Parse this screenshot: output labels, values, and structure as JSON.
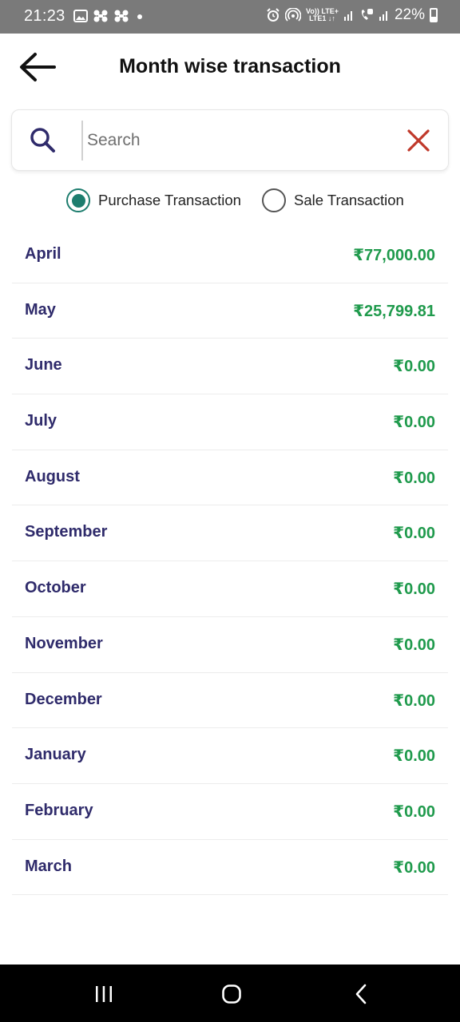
{
  "status_bar": {
    "time": "21:23",
    "network_top": "Vo)) LTE+",
    "network_bottom": "LTE1 ↓↑",
    "battery": "22%"
  },
  "header": {
    "title": "Month wise transaction"
  },
  "search": {
    "placeholder": "Search",
    "value": ""
  },
  "filter": {
    "options": [
      {
        "label": "Purchase Transaction",
        "selected": true
      },
      {
        "label": "Sale Transaction",
        "selected": false
      }
    ]
  },
  "months": [
    {
      "month": "April",
      "amount": "₹77,000.00"
    },
    {
      "month": "May",
      "amount": "₹25,799.81"
    },
    {
      "month": "June",
      "amount": "₹0.00"
    },
    {
      "month": "July",
      "amount": "₹0.00"
    },
    {
      "month": "August",
      "amount": "₹0.00"
    },
    {
      "month": "September",
      "amount": "₹0.00"
    },
    {
      "month": "October",
      "amount": "₹0.00"
    },
    {
      "month": "November",
      "amount": "₹0.00"
    },
    {
      "month": "December",
      "amount": "₹0.00"
    },
    {
      "month": "January",
      "amount": "₹0.00"
    },
    {
      "month": "February",
      "amount": "₹0.00"
    },
    {
      "month": "March",
      "amount": "₹0.00"
    }
  ],
  "colors": {
    "accent_radio": "#1d7d6e",
    "month_text": "#2f2b6b",
    "amount_text": "#1f9a4c",
    "clear_icon": "#c0392b",
    "search_icon": "#2f2b6b"
  },
  "icons": {
    "back": "arrow-left-icon",
    "search": "search-icon",
    "clear": "close-icon",
    "nav_recents": "recents-icon",
    "nav_home": "home-icon",
    "nav_back": "chevron-left-icon"
  }
}
